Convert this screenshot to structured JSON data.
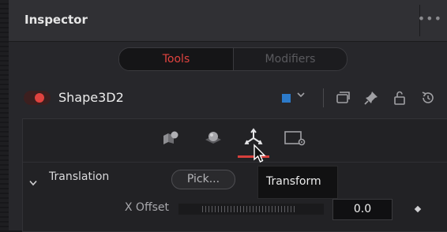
{
  "header": {
    "title": "Inspector",
    "menu_icon": "more-dots-icon"
  },
  "segmented": {
    "tools_label": "Tools",
    "modifiers_label": "Modifiers",
    "active": "Tools"
  },
  "node": {
    "name": "Shape3D2",
    "enabled": true,
    "color": "#2c7ac9",
    "icons": [
      "color-dropdown-icon",
      "versions-icon",
      "pin-icon",
      "lock-icon",
      "reset-icon"
    ]
  },
  "tabs": {
    "icons": [
      "controls-icon",
      "material-icon",
      "transform-icon",
      "settings-icon"
    ],
    "active": "transform-icon"
  },
  "tooltip": {
    "text": "Transform"
  },
  "section": {
    "label": "Translation",
    "pick_label": "Pick..."
  },
  "field": {
    "label": "X Offset",
    "value": "0.0"
  },
  "colors": {
    "accent": "#e0433f",
    "background": "#27272b",
    "swatch": "#2c7ac9"
  }
}
